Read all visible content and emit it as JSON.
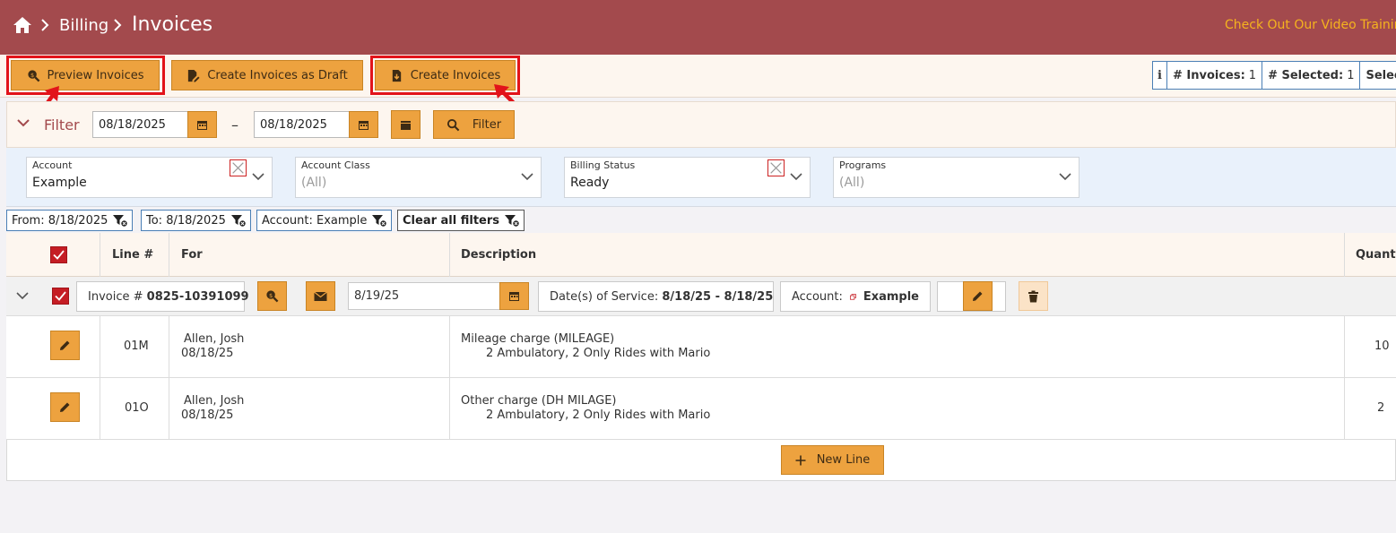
{
  "header": {
    "breadcrumb": [
      "Billing",
      "Invoices"
    ],
    "video_link": "Check Out Our Video Training"
  },
  "toolbar": {
    "preview_label": "Preview Invoices",
    "draft_label": "Create Invoices as Draft",
    "create_label": "Create Invoices",
    "stats": {
      "info": "i",
      "invoices_label": "# Invoices:",
      "invoices_value": "1",
      "selected_label": "# Selected:",
      "selected_value": "1",
      "selected_total_label": "Selected T"
    }
  },
  "filter": {
    "label": "Filter",
    "from_date": "08/18/2025",
    "to_date": "08/18/2025",
    "dash": "–",
    "button_label": "Filter"
  },
  "dropdowns": [
    {
      "label": "Account",
      "value": "Example"
    },
    {
      "label": "Account Class",
      "value": "(All)"
    },
    {
      "label": "Billing Status",
      "value": "Ready"
    },
    {
      "label": "Programs",
      "value": "(All)"
    }
  ],
  "chips": {
    "from": "From: 8/18/2025",
    "to": "To: 8/18/2025",
    "account": "Account: Example",
    "clear": "Clear all filters"
  },
  "table": {
    "headers": {
      "line": "Line #",
      "for": "For",
      "description": "Description",
      "quantity": "Quanti"
    },
    "invoice": {
      "number_label": "Invoice #",
      "number": "0825-10391099",
      "date": "8/19/25",
      "service_label": "Date(s) of Service:",
      "service_value": "8/18/25 - 8/18/25",
      "account_label": "Account:",
      "account_value": "Example"
    },
    "rows": [
      {
        "line": "01M",
        "for_name": "Allen, Josh",
        "for_date": "08/18/25",
        "desc_main": "Mileage charge (MILEAGE)",
        "desc_sub": "2 Ambulatory, 2 Only Rides with Mario",
        "quantity": "10"
      },
      {
        "line": "01O",
        "for_name": "Allen, Josh",
        "for_date": "08/18/25",
        "desc_main": "Other charge (DH MILAGE)",
        "desc_sub": "2 Ambulatory, 2 Only Rides with Mario",
        "quantity": "2"
      }
    ],
    "new_line_label": "New Line"
  }
}
